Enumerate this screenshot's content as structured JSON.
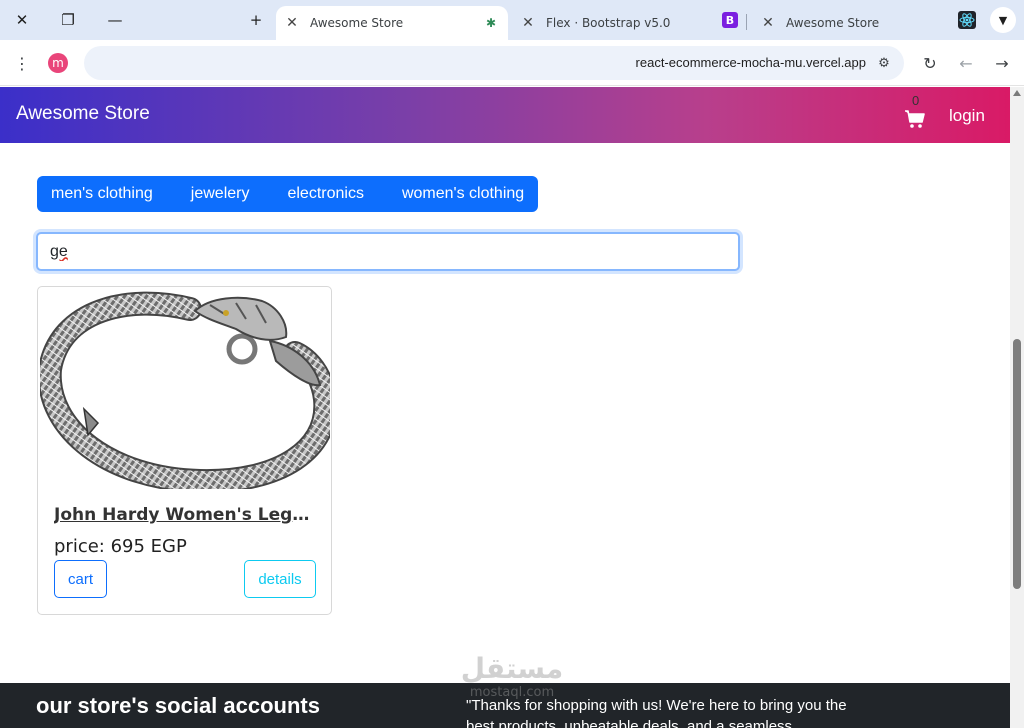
{
  "browser": {
    "tabs": [
      {
        "title": "Awesome Store",
        "active": true
      },
      {
        "title": "Flex · Bootstrap v5.0",
        "active": false
      },
      {
        "title": "Awesome Store",
        "active": false
      }
    ],
    "url": "react-ecommerce-mocha-mu.vercel.app",
    "profile_initial": "m"
  },
  "navbar": {
    "brand": "Awesome Store",
    "cart_count": "0",
    "login_label": "login"
  },
  "categories": [
    "men's clothing",
    "jewelery",
    "electronics",
    "women's clothing"
  ],
  "search": {
    "value": "ge"
  },
  "products": [
    {
      "title": "John Hardy Women's Legends Naga Gold & Silver Dragon Station Chain Bracelet",
      "price": "price: 695 EGP",
      "cart_label": "cart",
      "details_label": "details"
    }
  ],
  "footer": {
    "social_title": "our store's social accounts",
    "message": "\"Thanks for shopping with us! We're here to bring you the best products, unbeatable deals, and a seamless"
  },
  "watermark": "mostaql.com",
  "colors": {
    "primary": "#0d6efd",
    "info": "#0dcaf0",
    "footer": "#212529",
    "gradient_start": "#3b2fc9",
    "gradient_end": "#d91a66"
  }
}
